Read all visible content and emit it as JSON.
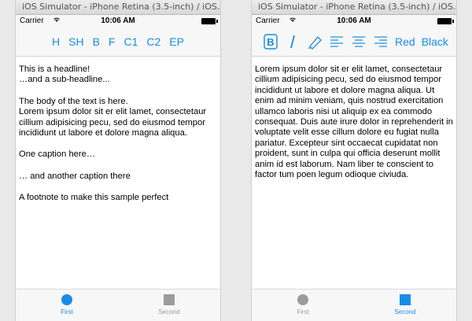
{
  "left": {
    "window_title": "iOS Simulator - iPhone Retina (3.5-inch) / iOS...",
    "status": {
      "carrier": "Carrier",
      "time": "10:06 AM"
    },
    "nav_items": [
      "H",
      "SH",
      "B",
      "F",
      "C1",
      "C2",
      "EP"
    ],
    "content": [
      "This is a headline!",
      "…and a sub-headline...",
      "The body of the text is here.",
      "Lorem ipsum dolor sit er elit lamet, consectetaur cillium adipisicing pecu, sed do eiusmod tempor incididunt ut labore et dolore magna aliqua.",
      "One caption here…",
      "… and another caption there",
      "A footnote to make this sample perfect"
    ],
    "tabs": {
      "first": "First",
      "second": "Second"
    },
    "active_tab": "first"
  },
  "right": {
    "window_title": "iOS Simulator - iPhone Retina (3.5-inch) / iOS...",
    "status": {
      "carrier": "Carrier",
      "time": "10:06 AM"
    },
    "toolbar_icons": [
      "bold-icon",
      "italic-icon",
      "highlighter-icon",
      "align-left-icon",
      "align-center-icon",
      "align-right-icon"
    ],
    "toolbar_words": {
      "red": "Red",
      "black": "Black"
    },
    "body": "Lorem ipsum dolor sit er elit lamet, consectetaur cillium adipisicing pecu, sed do eiusmod tempor incididunt ut labore et dolore magna aliqua. Ut enim ad minim veniam, quis nostrud exercitation ullamco laboris nisi ut aliquip ex ea commodo consequat. Duis aute irure dolor in reprehenderit in voluptate velit esse cillum dolore eu fugiat nulla pariatur. Excepteur sint occaecat cupidatat non proident, sunt in culpa qui officia deserunt mollit anim id est laborum. Nam liber te conscient to factor tum poen legum odioque civiuda.",
    "tabs": {
      "first": "First",
      "second": "Second"
    },
    "active_tab": "second"
  },
  "colors": {
    "accent": "#1a8ce6",
    "inactive": "#9c9c9c"
  }
}
